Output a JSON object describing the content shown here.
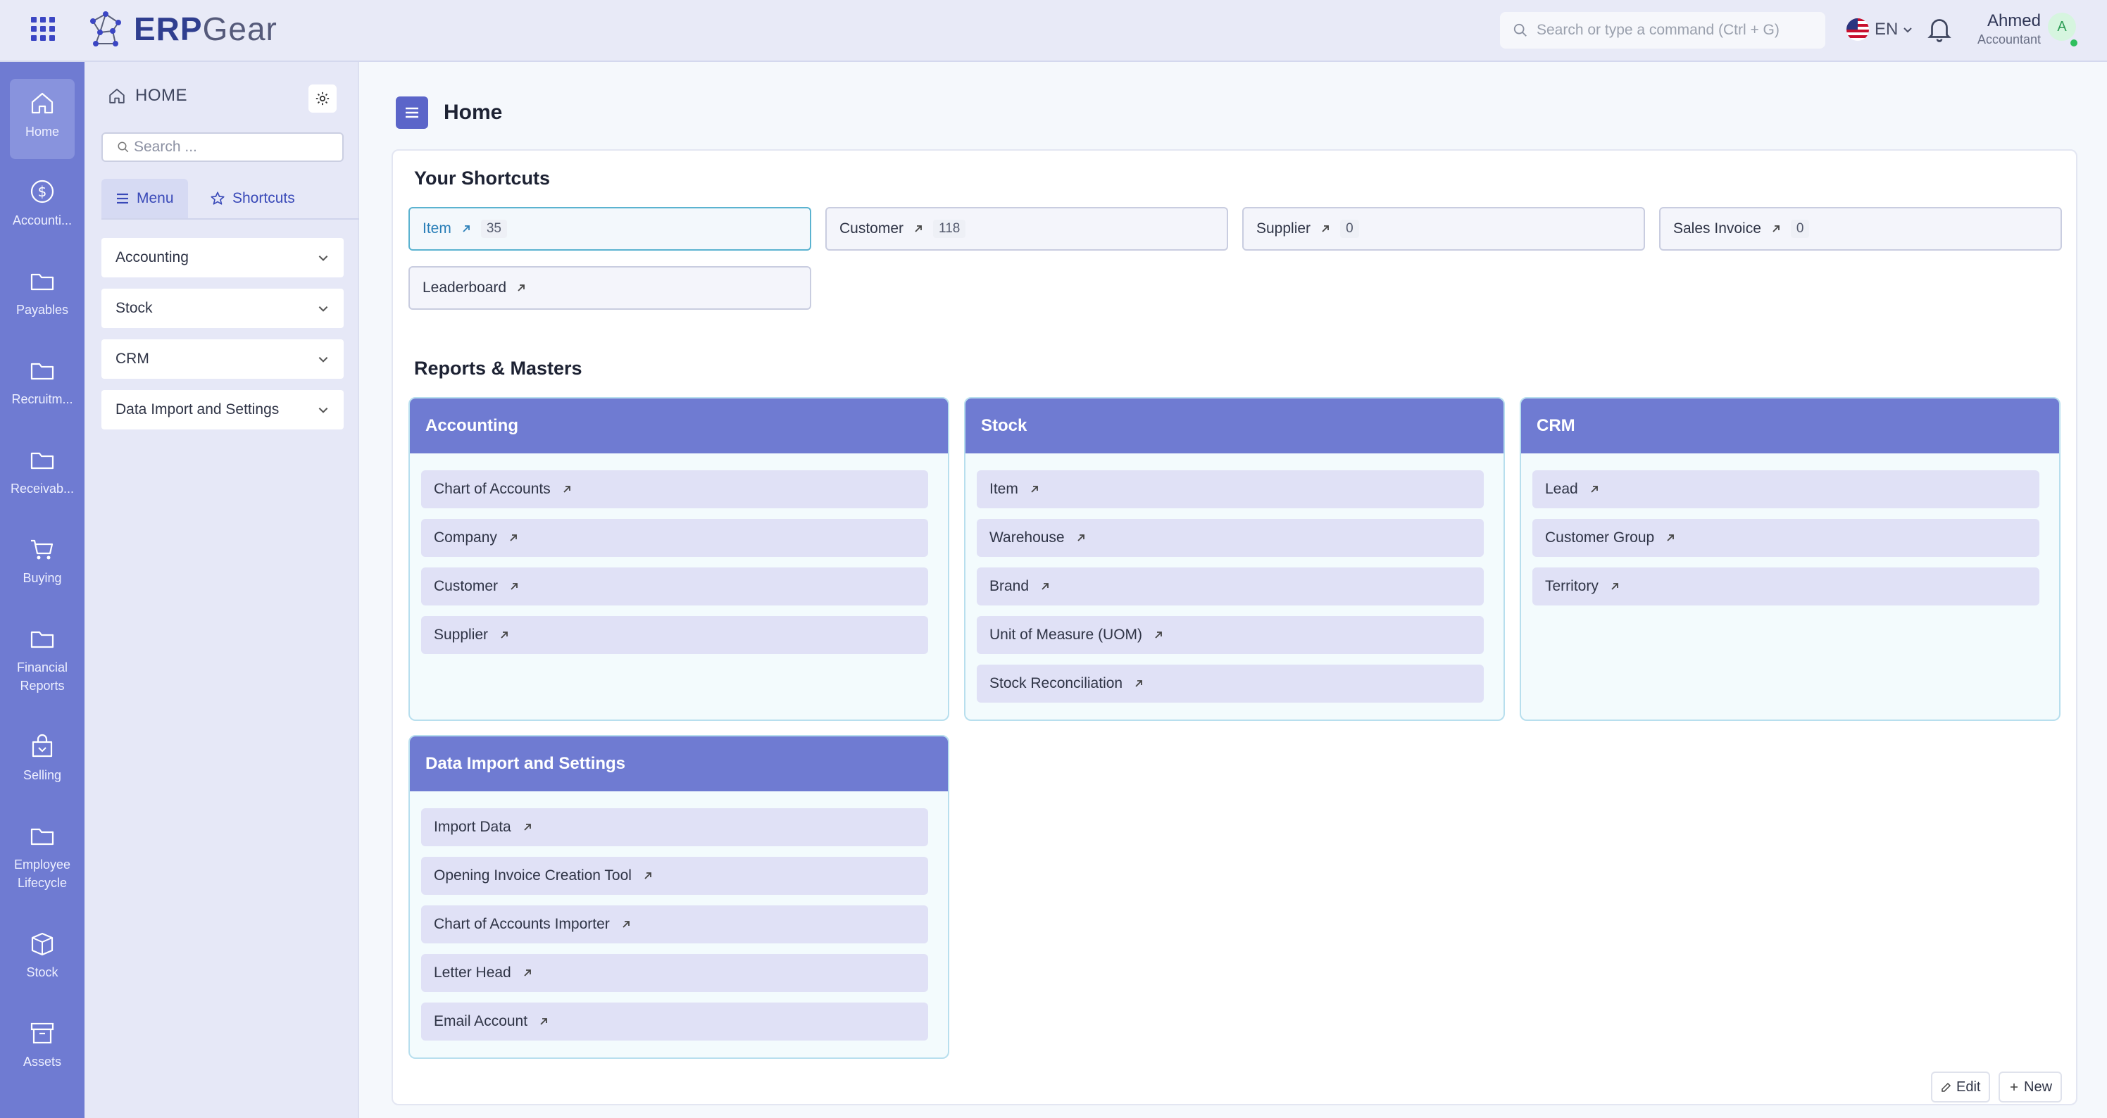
{
  "app": {
    "logo_text_bold": "ERP",
    "logo_text": "Gear",
    "search_placeholder": "Search or type a command (Ctrl + G)",
    "language": "EN",
    "user_name": "Ahmed",
    "user_role": "Accountant",
    "user_initial": "A"
  },
  "rail": [
    {
      "label": "Home",
      "icon": "home-icon"
    },
    {
      "label": "Accounti...",
      "icon": "dollar-circle-icon"
    },
    {
      "label": "Payables",
      "icon": "folder-icon"
    },
    {
      "label": "Recruitm...",
      "icon": "folder-icon"
    },
    {
      "label": "Receivab...",
      "icon": "folder-icon"
    },
    {
      "label": "Buying",
      "icon": "cart-icon"
    },
    {
      "label": "Financial Reports",
      "icon": "folder-icon"
    },
    {
      "label": "Selling",
      "icon": "shopping-bag-icon"
    },
    {
      "label": "Employee Lifecycle",
      "icon": "folder-icon"
    },
    {
      "label": "Stock",
      "icon": "box-icon"
    },
    {
      "label": "Assets",
      "icon": "archive-icon"
    }
  ],
  "side": {
    "title": "HOME",
    "search_placeholder": "Search ...",
    "tabs": {
      "menu": "Menu",
      "shortcuts": "Shortcuts"
    },
    "items": [
      "Accounting",
      "Stock",
      "CRM",
      "Data Import and Settings"
    ]
  },
  "page": {
    "title": "Home",
    "shortcuts_title": "Your Shortcuts",
    "reports_title": "Reports & Masters",
    "edit_label": "Edit",
    "new_label": "New"
  },
  "shortcuts": [
    {
      "label": "Item",
      "count": "35"
    },
    {
      "label": "Customer",
      "count": "118"
    },
    {
      "label": "Supplier",
      "count": "0"
    },
    {
      "label": "Sales Invoice",
      "count": "0"
    },
    {
      "label": "Leaderboard"
    }
  ],
  "reports": [
    {
      "title": "Accounting",
      "links": [
        "Chart of Accounts",
        "Company",
        "Customer",
        "Supplier"
      ]
    },
    {
      "title": "Stock",
      "links": [
        "Item",
        "Warehouse",
        "Brand",
        "Unit of Measure (UOM)",
        "Stock Reconciliation"
      ]
    },
    {
      "title": "CRM",
      "links": [
        "Lead",
        "Customer Group",
        "Territory"
      ]
    },
    {
      "title": "Data Import and Settings",
      "links": [
        "Import Data",
        "Opening Invoice Creation Tool",
        "Chart of Accounts Importer",
        "Letter Head",
        "Email Account"
      ]
    }
  ],
  "colors": {
    "accent": "#6f7bd2",
    "primary": "#3b46c4",
    "online": "#2fbf5e"
  }
}
